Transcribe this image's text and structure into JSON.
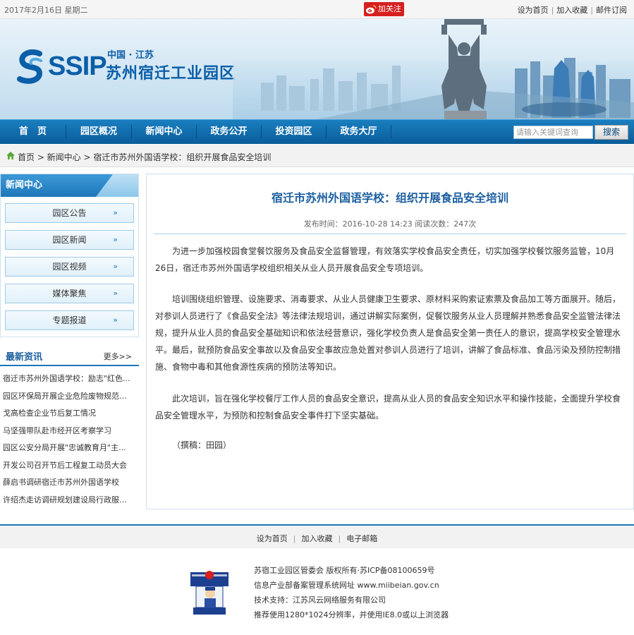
{
  "topbar": {
    "date": "2017年2月16日 星期二",
    "follow_label": "加关注",
    "links": [
      "设为首页",
      "加入收藏",
      "邮件订阅"
    ]
  },
  "banner": {
    "logo_text": "SSIP",
    "logo_sub": "中国 · 江苏",
    "logo_main": "苏州宿迁工业园区"
  },
  "nav": {
    "items": [
      "首　页",
      "园区概况",
      "新闻中心",
      "政务公开",
      "投资园区",
      "政务大厅"
    ],
    "search_placeholder": "请输入关键词查询",
    "search_button": "搜索"
  },
  "breadcrumb": {
    "text": "首页 > 新闻中心 > 宿迁市苏州外国语学校：组织开展食品安全培训"
  },
  "sidebar": {
    "news_title": "新闻中心",
    "news_items": [
      "园区公告",
      "园区新闻",
      "园区视频",
      "媒体聚焦",
      "专题报道"
    ],
    "arrow": "»",
    "latest_title": "最新资讯",
    "more_label": "更多>>",
    "latest_items": [
      "宿迁市苏州外国语学校：励志\"红色...",
      "园区环保局开展企业危险废物规范化...",
      "戈高检查企业节后复工情况",
      "马坚强带队赴市经开区考察学习",
      "园区公安分局开展\"忠诚教育月\"主...",
      "开发公司召开节后工程复工动员大会",
      "薛启书调研宿迁市苏州外国语学校",
      "许绍杰走访调研规划建设局行政服务..."
    ]
  },
  "article": {
    "title": "宿迁市苏州外国语学校：组织开展食品安全培训",
    "meta": "发布时间：2016-10-28 14:23  阅读次数：247次",
    "paragraphs": [
      "为进一步加强校园食堂餐饮服务及食品安全监督管理，有效落实学校食品安全责任，切实加强学校餐饮服务监管，10月26日，宿迁市苏州外国语学校组织相关从业人员开展食品安全专项培训。",
      "培训围绕组织管理、设施要求、消毒要求、从业人员健康卫生要求、原材料采购索证索票及食品加工等方面展开。随后，对参训人员进行了《食品安全法》等法律法规培训，通过讲解实际案例，促餐饮服务从业人员理解并熟悉食品安全监管法律法规，提升从业人员的食品安全基础知识和依法经营意识，强化学校负责人是食品安全第一责任人的意识，提高学校安全管理水平。最后，就预防食品安全事故以及食品安全事故应急处置对参训人员进行了培训，讲解了食品标准、食品污染及预防控制措施、食物中毒和其他食源性疾病的预防法等知识。",
      "此次培训，旨在强化学校餐厅工作人员的食品安全意识，提高从业人员的食品安全知识水平和操作技能，全面提升学校食品安全管理水平，为预防和控制食品安全事件打下坚实基础。"
    ],
    "author": "（撰稿：田园）"
  },
  "footer": {
    "links": [
      "设为首页",
      "加入收藏",
      "电子邮箱"
    ],
    "info": [
      "苏宿工业园区管委会 版权所有·苏ICP备08100659号",
      "信息产业部备案管理系统网址 www.miibeian.gov.cn",
      "技术支持：江苏风云网络服务有限公司",
      "推荐使用1280*1024分辨率，并使用IE8.0或以上浏览器"
    ]
  },
  "colors": {
    "brand_blue": "#0b5ea8",
    "nav_blue": "#1c76b9",
    "follow_red": "#d71f1f"
  }
}
